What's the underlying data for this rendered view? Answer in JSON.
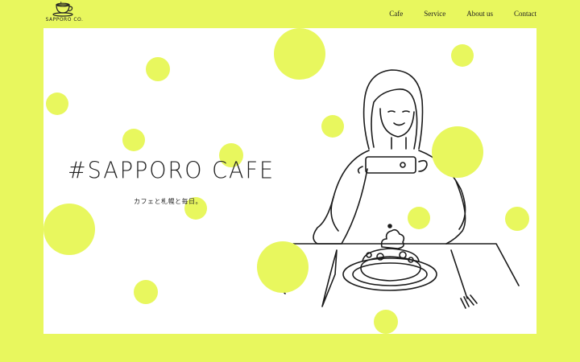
{
  "logo": {
    "text": "SAPPORO CO.",
    "icon": "coffee-cup-icon"
  },
  "nav": {
    "items": [
      "Cafe",
      "Service",
      "About us",
      "Contact"
    ]
  },
  "hero": {
    "title": "#SAPPORO CAFE",
    "subtitle": "カフェと札幌と毎日。",
    "illustration": "woman-photographing-pancakes-illustration"
  },
  "colors": {
    "accent": "#e8f75e",
    "ink": "#222222",
    "panel": "#ffffff"
  }
}
